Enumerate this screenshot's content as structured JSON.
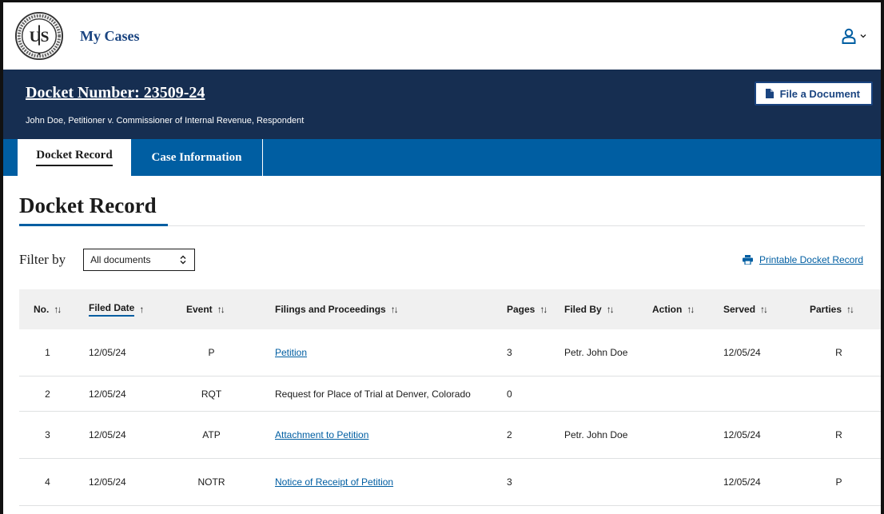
{
  "header": {
    "seal_text": "UNITED STATES TAX COURT",
    "seal_letters": "US",
    "nav_link": "My Cases",
    "user_icon": "user-icon"
  },
  "case": {
    "docket_number": "Docket Number: 23509-24",
    "caption": "John Doe, Petitioner v. Commissioner of Internal Revenue, Respondent",
    "file_document_label": "File a Document",
    "file_icon": "file-icon"
  },
  "tabs": [
    {
      "label": "Docket Record",
      "active": true
    },
    {
      "label": "Case Information",
      "active": false
    }
  ],
  "page_title": "Docket Record",
  "filter": {
    "label": "Filter by",
    "selected": "All documents"
  },
  "print_link": "Printable Docket Record",
  "table": {
    "columns": [
      "No.",
      "Filed Date",
      "Event",
      "Filings and Proceedings",
      "Pages",
      "Filed By",
      "Action",
      "Served",
      "Parties"
    ],
    "rows": [
      {
        "no": "1",
        "date": "12/05/24",
        "event": "P",
        "filing": "Petition",
        "filing_link": true,
        "pages": "3",
        "filed_by": "Petr. John Doe",
        "action": "",
        "served": "12/05/24",
        "parties": "R"
      },
      {
        "no": "2",
        "date": "12/05/24",
        "event": "RQT",
        "filing": "Request for Place of Trial at Denver, Colorado",
        "filing_link": false,
        "pages": "0",
        "filed_by": "",
        "action": "",
        "served": "",
        "parties": ""
      },
      {
        "no": "3",
        "date": "12/05/24",
        "event": "ATP",
        "filing": "Attachment to Petition",
        "filing_link": true,
        "pages": "2",
        "filed_by": "Petr. John Doe",
        "action": "",
        "served": "12/05/24",
        "parties": "R"
      },
      {
        "no": "4",
        "date": "12/05/24",
        "event": "NOTR",
        "filing": "Notice of Receipt of Petition",
        "filing_link": true,
        "pages": "3",
        "filed_by": "",
        "action": "",
        "served": "12/05/24",
        "parties": "P"
      }
    ]
  },
  "colors": {
    "banner": "#162e51",
    "tabs": "#005ea2",
    "link": "#005ea2",
    "nav": "#1a4480"
  }
}
